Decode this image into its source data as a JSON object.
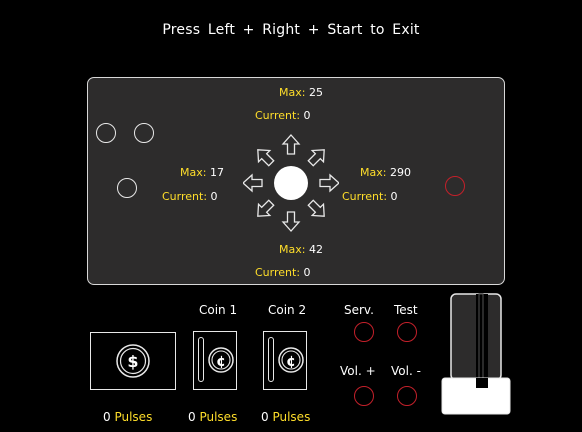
{
  "header": {
    "exit_hint": "Press  Left + Right + Start  to Exit"
  },
  "stick": {
    "up": {
      "max_label": "Max:",
      "max_value": "25",
      "current_label": "Current:",
      "current_value": "0"
    },
    "left": {
      "max_label": "Max:",
      "max_value": "17",
      "current_label": "Current:",
      "current_value": "0"
    },
    "right": {
      "max_label": "Max:",
      "max_value": "290",
      "current_label": "Current:",
      "current_value": "0"
    },
    "down": {
      "max_label": "Max:",
      "max_value": "42",
      "current_label": "Current:",
      "current_value": "0"
    }
  },
  "coins": {
    "coin1_label": "Coin 1",
    "coin2_label": "Coin 2",
    "dollar_symbol": "$",
    "cent_symbol": "¢",
    "bill_pulses_value": "0",
    "coin1_pulses_value": "0",
    "coin2_pulses_value": "0",
    "pulses_label": "Pulses"
  },
  "service": {
    "serv_label": "Serv.",
    "test_label": "Test",
    "vol_up_label": "Vol. +",
    "vol_down_label": "Vol. -"
  },
  "colors": {
    "accent": "#ffde2a",
    "indicator": "#c3202a",
    "panel": "#2d2c2c"
  },
  "icons": [
    "arrow-up-icon",
    "arrow-down-icon",
    "arrow-left-icon",
    "arrow-right-icon",
    "arrow-up-left-icon",
    "arrow-up-right-icon",
    "arrow-down-left-icon",
    "arrow-down-right-icon",
    "dollar-icon",
    "cent-icon",
    "slider-icon"
  ]
}
